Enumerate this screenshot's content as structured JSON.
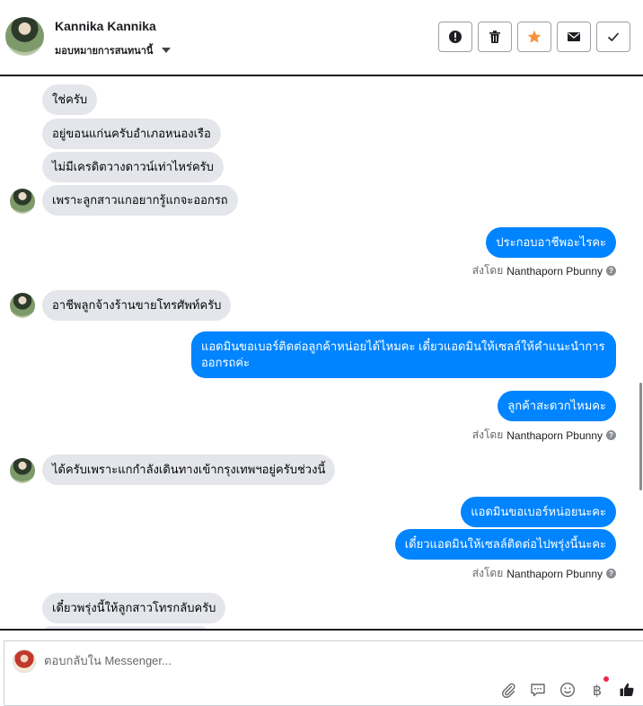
{
  "header": {
    "name": "Kannika Kannika",
    "assign_label": "มอบหมายการสนทนานี้",
    "toolbar": [
      {
        "name": "report-button",
        "icon": "exclamation-icon"
      },
      {
        "name": "delete-button",
        "icon": "trash-icon"
      },
      {
        "name": "star-button",
        "icon": "star-icon"
      },
      {
        "name": "mark-unread-button",
        "icon": "envelope-icon"
      },
      {
        "name": "mark-done-button",
        "icon": "check-icon"
      }
    ]
  },
  "messages": [
    {
      "dir": "in",
      "text": "ใช่ครับ"
    },
    {
      "dir": "in",
      "text": "อยู่ขอนแก่นครับอำเภอหนองเรือ"
    },
    {
      "dir": "in",
      "text": "ไม่มีเครดิตวางดาวน์เท่าไหร่ครับ"
    },
    {
      "dir": "in",
      "text": "เพราะลูกสาวแกอยากรู้แกจะออกรถ"
    },
    {
      "dir": "out",
      "text": "ประกอบอาชีพอะไรคะ"
    },
    {
      "dir": "in",
      "text": "อาชีพลูกจ้างร้านขายโทรศัพท์ครับ"
    },
    {
      "dir": "out",
      "text": "แอดมินขอเบอร์ติดต่อลูกค้าหน่อยได้ไหมคะ เดี๋ยวแอดมินให้เซลล์ให้คำแนะนำการออกรถค่ะ"
    },
    {
      "dir": "out",
      "text": "ลูกค้าสะดวกไหมคะ"
    },
    {
      "dir": "in",
      "text": "ได้ครับเพราะแกกำลังเดินทางเข้ากรุงเทพฯอยู่ครับช่วงนี้"
    },
    {
      "dir": "out",
      "text": "แอดมินขอเบอร์หน่อยนะคะ"
    },
    {
      "dir": "out",
      "text": "เดี๋ยวแอดมินให้เซลล์ติดต่อไปพรุ่งนี้นะคะ"
    },
    {
      "dir": "in",
      "text": "เดี๋ยวพรุ่งนี้ให้ลูกสาวโทรกลับครับ"
    }
  ],
  "sent_by": {
    "prefix": "ส่งโดย",
    "agent": "Nanthaporn Pbunny",
    "info_icon": "question-icon"
  },
  "composer": {
    "placeholder": "ตอบกลับใน Messenger...",
    "icons": [
      "paperclip-icon",
      "saved-reply-icon",
      "emoji-icon",
      "baht-payment-icon",
      "thumbs-up-icon"
    ],
    "baht_symbol": "฿"
  },
  "colors": {
    "outgoing_bubble": "#0084ff",
    "incoming_bubble": "#e4e6eb",
    "star": "#f7923b",
    "notification_dot": "#f02849"
  }
}
